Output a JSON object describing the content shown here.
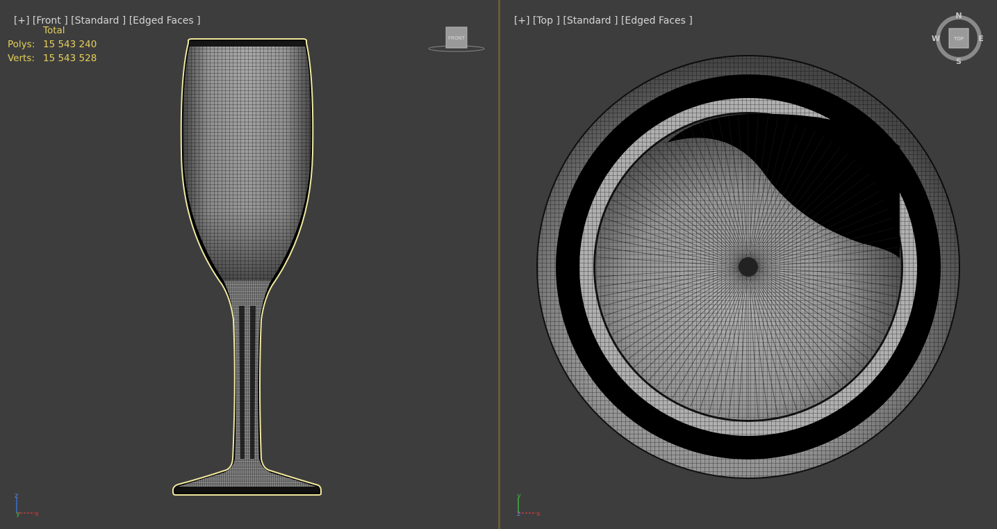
{
  "viewports": [
    {
      "label_plus": "[+]",
      "label_view": "[Front ]",
      "label_shading": "[Standard ]",
      "label_mode": "[Edged Faces ]",
      "viewcube_face": "FRONT"
    },
    {
      "label_plus": "[+]",
      "label_view": "[Top ]",
      "label_shading": "[Standard ]",
      "label_mode": "[Edged Faces ]",
      "viewcube_face": "TOP",
      "compass": {
        "n": "N",
        "s": "S",
        "e": "E",
        "w": "W"
      }
    }
  ],
  "stats": {
    "header": "Total",
    "polys_label": "Polys:",
    "polys_value": "15 543 240",
    "verts_label": "Verts:",
    "verts_value": "15 543 528"
  },
  "axis_labels": {
    "x": "x",
    "y": "y",
    "z": "z"
  },
  "colors": {
    "viewport_bg": "#3d3d3d",
    "selection_outline": "#f2e9a0",
    "stats_text": "#e4cf5c",
    "axis_x": "#c83c3c",
    "axis_y": "#3cb43c",
    "axis_z": "#3c6ed2"
  }
}
